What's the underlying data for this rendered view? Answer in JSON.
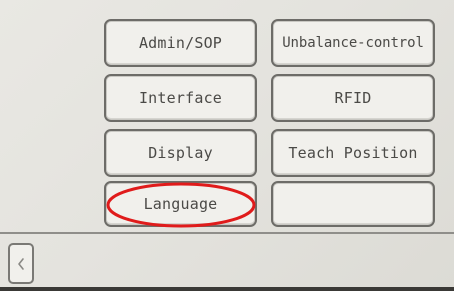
{
  "menu": {
    "admin_sop": "Admin/SOP",
    "unbalance_control": "Unbalance-control",
    "interface": "Interface",
    "rfid": "RFID",
    "display": "Display",
    "teach_position": "Teach Position",
    "language": "Language",
    "empty_slot": ""
  },
  "footer": {
    "back_icon": "chevron-left-icon",
    "back_glyph": "‹"
  },
  "colors": {
    "screen_bg": "#e6e5e0",
    "button_bg": "#f1f0ec",
    "button_border": "#6d6c68",
    "text": "#4b4a47",
    "highlight": "#e01b1b"
  },
  "annotation": {
    "type": "ellipse",
    "target": "language",
    "color": "#e01b1b"
  }
}
